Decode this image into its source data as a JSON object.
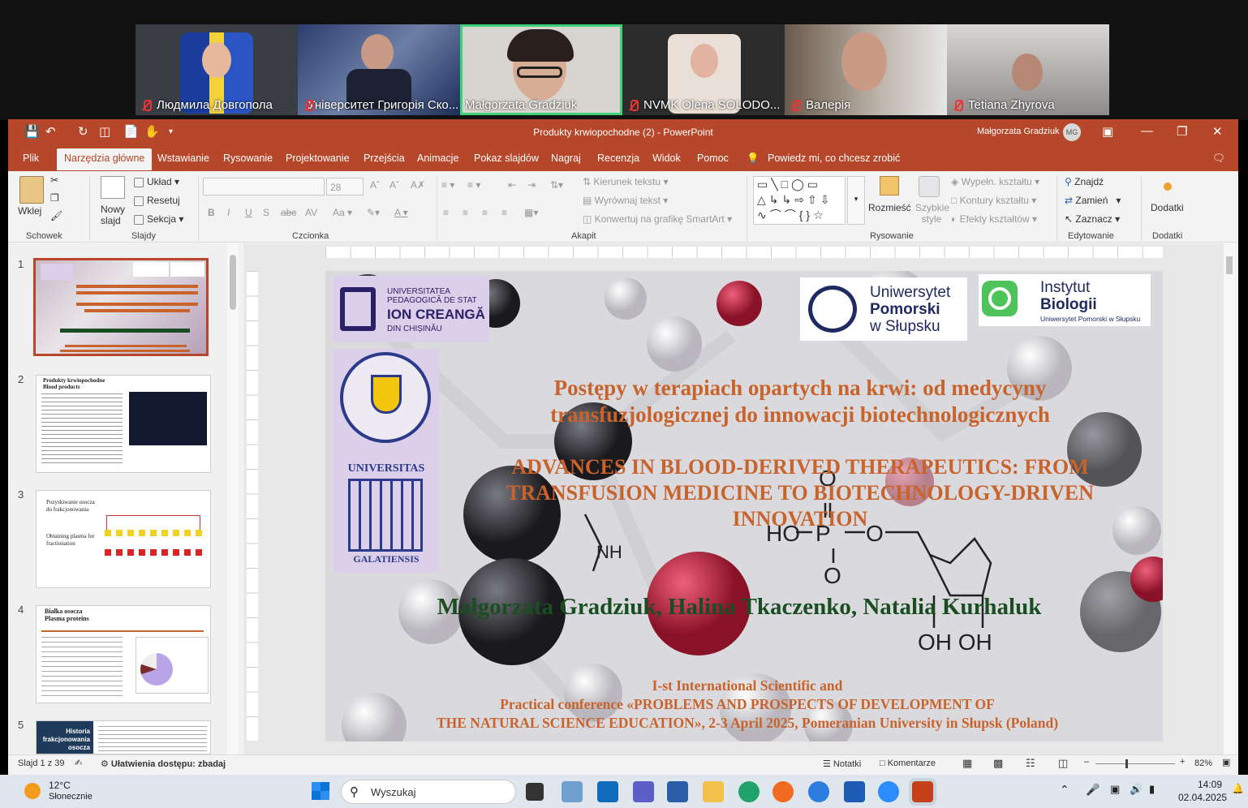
{
  "meeting": {
    "participants": [
      {
        "name": "Людмила Довгопола",
        "muted": true
      },
      {
        "name": "Університет Григорія Ско...",
        "muted": true
      },
      {
        "name": "Małgorzata Gradziuk",
        "muted": false
      },
      {
        "name": "NVMK Olena SOLODO...",
        "muted": true
      },
      {
        "name": "Валерія",
        "muted": true
      },
      {
        "name": "Tetiana Zhyrova",
        "muted": true
      }
    ]
  },
  "app": {
    "title": "Produkty krwiopochodne (2)  -  PowerPoint",
    "user": "Małgorzata Gradziuk",
    "user_initials": "MG",
    "accent": "#b7472a"
  },
  "tabs": [
    "Plik",
    "Narzędzia główne",
    "Wstawianie",
    "Rysowanie",
    "Projektowanie",
    "Przejścia",
    "Animacje",
    "Pokaz slajdów",
    "Nagraj",
    "Recenzja",
    "Widok",
    "Pomoc"
  ],
  "tell_me": "Powiedz mi, co chcesz zrobić",
  "ribbon": {
    "clipboard": {
      "paste": "Wklej",
      "group": "Schowek"
    },
    "slides": {
      "new_slide": "Nowy slajd",
      "layout": "Układ",
      "reset": "Resetuj",
      "section": "Sekcja",
      "group": "Slajdy"
    },
    "font": {
      "font_name": "",
      "font_size": "28",
      "group": "Czcionka"
    },
    "paragraph": {
      "text_direction": "Kierunek tekstu",
      "align_text": "Wyrównaj tekst",
      "smartart": "Konwertuj na grafikę SmartArt",
      "group": "Akapit"
    },
    "drawing": {
      "arrange": "Rozmieść",
      "quick_styles": "Szybkie style",
      "fill": "Wypełn. kształtu",
      "outline": "Kontury kształtu",
      "effects": "Efekty kształtów",
      "group": "Rysowanie"
    },
    "editing": {
      "find": "Znajdź",
      "replace": "Zamień",
      "select": "Zaznacz",
      "group": "Edytowanie"
    },
    "addins": {
      "label": "Dodatki",
      "group": "Dodatki"
    }
  },
  "thumbnails": [
    {
      "num": "1"
    },
    {
      "num": "2",
      "title": "Produkty krwiopochodne\nBlood products"
    },
    {
      "num": "3",
      "title": "Pozyskiwanie osocza do frakcjonowania",
      "subtitle": "Obtaining plasma for fractionation"
    },
    {
      "num": "4",
      "title": "Białka osocza\nPlasma proteins"
    },
    {
      "num": "5",
      "title": "Historia frakcjonowania osocza"
    }
  ],
  "slide": {
    "logo_ion": {
      "line1": "UNIVERSITATEA",
      "line2": "PEDAGOGICĂ DE STAT",
      "line3": "ION CREANGĂ",
      "line4": "DIN CHIȘINĂU"
    },
    "logo_upsl": {
      "line1": "Uniwersytet",
      "line2": "Pomorski",
      "line3": "w Słupsku"
    },
    "logo_ib": {
      "line1": "Instytut",
      "line2": "Biologii",
      "line3": "Uniwersytet Pomorski w Słupsku"
    },
    "logo_galati": {
      "line1": "UNIVERSITAS",
      "line2": "GALATIENSIS"
    },
    "title_pl": "Postępy w terapiach opartych na krwi: od medycyny transfuzjologicznej do innowacji biotechnologicznych",
    "title_en": "ADVANCES IN BLOOD-DERIVED THERAPEUTICS: FROM TRANSFUSION MEDICINE TO BIOTECHNOLOGY-DRIVEN INNOVATION",
    "authors": "Małgorzata Gradziuk, Halina Tkaczenko, Natalia Kurhaluk",
    "conf_line1": "I-st International Scientific and",
    "conf_line2": "Practical conference «PROBLEMS AND PROSPECTS OF DEVELOPMENT OF",
    "conf_line3": "THE NATURAL SCIENCE EDUCATION», 2-3 April 2025, Pomeranian University in Słupsk (Poland)",
    "chem": {
      "ho": "HO",
      "p": "P",
      "o": "O",
      "ominus": "O",
      "nh": "NH",
      "o2": "O",
      "ohoh": "OH OH"
    }
  },
  "status": {
    "slide_of": "Slajd 1 z 39",
    "accessibility": "Ułatwienia dostępu: zbadaj",
    "notes": "Notatki",
    "comments": "Komentarze",
    "zoom": "82%"
  },
  "taskbar": {
    "weather_temp": "12°C",
    "weather_desc": "Słonecznie",
    "search": "Wyszukaj",
    "time": "14:09",
    "date": "02.04.2025"
  }
}
